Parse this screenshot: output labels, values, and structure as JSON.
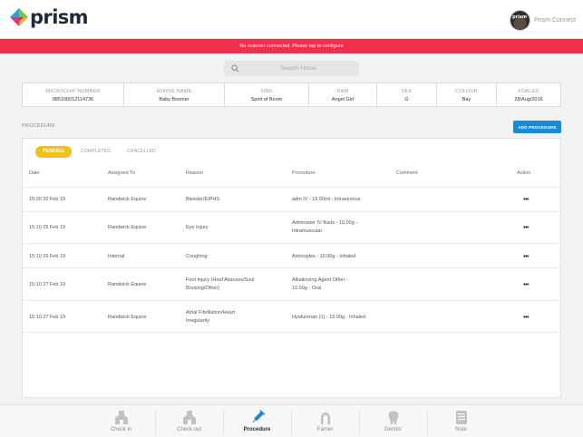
{
  "header": {
    "logo_text": "prism",
    "connect_label": "Prism Connect",
    "avatar_text": "prism"
  },
  "alert": {
    "text": "No scanner connected. Please tap to configure"
  },
  "search": {
    "placeholder": "Search Horse"
  },
  "horse": {
    "fields": [
      {
        "label": "MICROCHIP NUMBER",
        "value": "985100012114736"
      },
      {
        "label": "HORSE NAME",
        "value": "Baby Boomer"
      },
      {
        "label": "SIRE",
        "value": "Spirit of Boom"
      },
      {
        "label": "DAM",
        "value": "Angel Girl"
      },
      {
        "label": "SEX",
        "value": "G"
      },
      {
        "label": "COLOUR",
        "value": "Bay"
      },
      {
        "label": "FOALED",
        "value": "28/Aug/2016"
      }
    ]
  },
  "procedure": {
    "section_label": "PROCEDURE",
    "add_button": "ADD PROCEDURE",
    "filters": [
      "PENDING",
      "COMPLETED",
      "CANCELLED"
    ],
    "active_filter": "PENDING",
    "columns": [
      "Date",
      "Assigned To",
      "Reason",
      "Procedure",
      "Comment",
      "Action"
    ],
    "rows": [
      {
        "date": "15:00 20 Feb 19",
        "assigned": "Randwick Equine",
        "reason": [
          "Bleeder/EIPHS"
        ],
        "procedure": [
          "adm IV - 15.00ml - Intravenous"
        ],
        "comment": ""
      },
      {
        "date": "15:10 25 Feb 19",
        "assigned": "Randwick Equine",
        "reason": [
          "Eye Injury"
        ],
        "procedure": [
          "Administer IV fluids  - 10.00g -",
          "Intramuscular"
        ],
        "comment": ""
      },
      {
        "date": "15:10 26 Feb 19",
        "assigned": "Internal",
        "reason": [
          "Coughing"
        ],
        "procedure": [
          "Aminoplex - 10.00g - Inhaled"
        ],
        "comment": ""
      },
      {
        "date": "15:10 27 Feb 19",
        "assigned": "Randwick Equine",
        "reason": [
          "Foot Injury (Hoof Abscess/Soul",
          "Bruising/Other)"
        ],
        "procedure": [
          "Alkalinizing Agent Other -",
          "10.00g - Oral"
        ],
        "comment": ""
      },
      {
        "date": "15:10 27 Feb 19",
        "assigned": "Randwick Equine",
        "reason": [
          "Atrial Fibrillation/Heart",
          "Irregularity"
        ],
        "procedure": [
          "Hyaluronan (1) - 10.00g - Inhaled"
        ],
        "comment": ""
      }
    ],
    "action_icon": "more-horizontal-icon",
    "action_glyph": "•••"
  },
  "bottom_nav": {
    "items": [
      {
        "label": "Check in",
        "icon": "check-in-icon"
      },
      {
        "label": "Check out",
        "icon": "check-out-icon"
      },
      {
        "label": "Procedure",
        "icon": "syringe-icon",
        "active": true
      },
      {
        "label": "Farrier",
        "icon": "horseshoe-icon"
      },
      {
        "label": "Dentist",
        "icon": "tooth-icon"
      },
      {
        "label": "Note",
        "icon": "note-icon"
      }
    ]
  },
  "colors": {
    "alert": "#f0304a",
    "accent": "#1c8ad1",
    "active_pill": "#f3c018",
    "text_dark": "#1e2a3a"
  }
}
